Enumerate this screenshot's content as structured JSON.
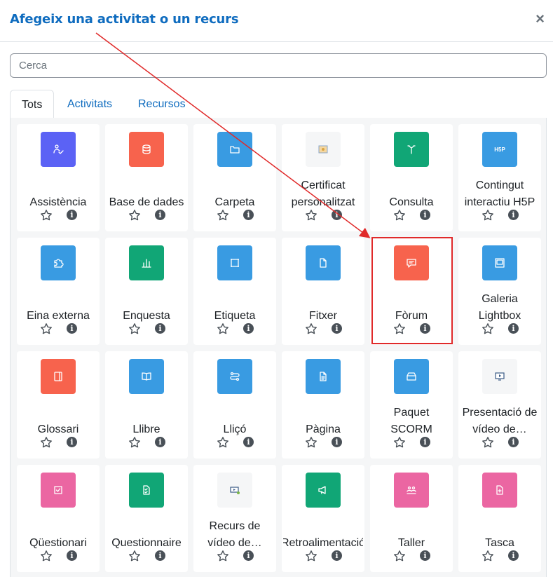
{
  "dialog": {
    "title": "Afegeix una activitat o un recurs",
    "close_label": "×"
  },
  "search": {
    "placeholder": "Cerca",
    "value": ""
  },
  "tabs": [
    {
      "label": "Tots",
      "active": true
    },
    {
      "label": "Activitats",
      "active": false
    },
    {
      "label": "Recursos",
      "active": false
    }
  ],
  "colors": {
    "accent": "#0f6cbf",
    "purple": "#5b62f5",
    "orange": "#f7634d",
    "blue": "#399be2",
    "green": "#11a676",
    "pink": "#eb66a2",
    "annotation_red": "#e02a2a"
  },
  "modules": [
    {
      "label": "Assistència",
      "icon": "assistance-icon",
      "color": "#5b62f5"
    },
    {
      "label": "Base de dades",
      "icon": "database-icon",
      "color": "#f7634d"
    },
    {
      "label": "Carpeta",
      "icon": "folder-icon",
      "color": "#399be2"
    },
    {
      "label": "Certificat personalitzat",
      "icon": "certificate-icon",
      "color": "plain"
    },
    {
      "label": "Consulta",
      "icon": "choice-icon",
      "color": "#11a676"
    },
    {
      "label": "Contingut interactiu H5P",
      "icon": "h5p-icon",
      "icon_text": "H5P",
      "color": "#399be2"
    },
    {
      "label": "Eina externa",
      "icon": "puzzle-icon",
      "color": "#399be2"
    },
    {
      "label": "Enquesta",
      "icon": "bar-chart-icon",
      "color": "#11a676"
    },
    {
      "label": "Etiqueta",
      "icon": "label-icon",
      "color": "#399be2"
    },
    {
      "label": "Fitxer",
      "icon": "file-icon",
      "color": "#399be2"
    },
    {
      "label": "Fòrum",
      "icon": "forum-icon",
      "color": "#f7634d"
    },
    {
      "label": "Galeria Lightbox",
      "icon": "gallery-icon",
      "color": "#399be2"
    },
    {
      "label": "Glossari",
      "icon": "glossary-icon",
      "color": "#f7634d"
    },
    {
      "label": "Llibre",
      "icon": "book-icon",
      "color": "#399be2"
    },
    {
      "label": "Lliçó",
      "icon": "lesson-icon",
      "color": "#399be2"
    },
    {
      "label": "Pàgina",
      "icon": "page-icon",
      "color": "#399be2"
    },
    {
      "label": "Paquet SCORM",
      "icon": "scorm-icon",
      "color": "#399be2"
    },
    {
      "label": "Presentació de vídeo de…",
      "icon": "video-presentation-icon",
      "color": "plain"
    },
    {
      "label": "Qüestionari",
      "icon": "quiz-icon",
      "color": "#eb66a2"
    },
    {
      "label": "Questionnaire",
      "icon": "questionnaire-icon",
      "color": "#11a676"
    },
    {
      "label": "Recurs de vídeo de…",
      "icon": "video-resource-icon",
      "color": "plain"
    },
    {
      "label": "Retroalimentació",
      "icon": "feedback-icon",
      "color": "#11a676"
    },
    {
      "label": "Taller",
      "icon": "workshop-icon",
      "color": "#eb66a2"
    },
    {
      "label": "Tasca",
      "icon": "assignment-icon",
      "color": "#eb66a2"
    }
  ],
  "card_actions": {
    "star_icon": "star-icon",
    "info_glyph": "i"
  }
}
